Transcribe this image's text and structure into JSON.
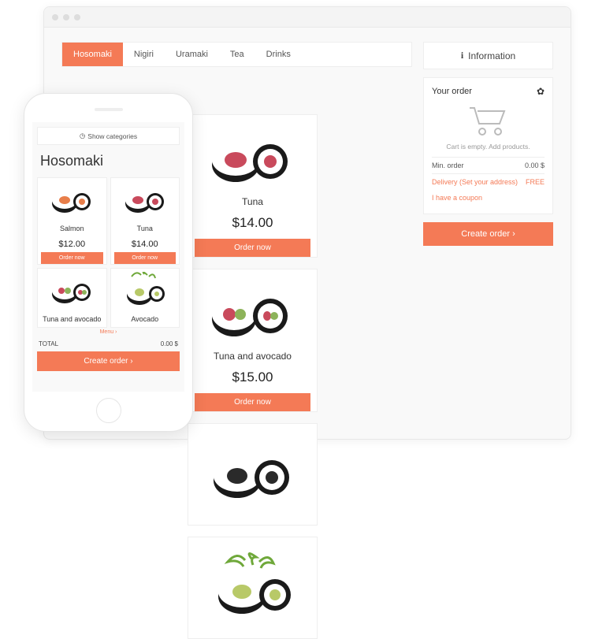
{
  "colors": {
    "accent": "#f47a56"
  },
  "tabs": [
    "Hosomaki",
    "Nigiri",
    "Uramaki",
    "Tea",
    "Drinks"
  ],
  "active_tab": "Hosomaki",
  "products": [
    {
      "name": "Tuna",
      "price": "$14.00",
      "cta": "Order now"
    },
    {
      "name": "Tuna and avocado",
      "price": "$15.00",
      "cta": "Order now"
    }
  ],
  "sidebar": {
    "info_label": "Information",
    "order_title": "Your order",
    "empty_text": "Cart is empty. Add products.",
    "min_order_label": "Min. order",
    "min_order_value": "0.00 $",
    "delivery_label": "Delivery (Set your address)",
    "delivery_value": "FREE",
    "coupon_label": "I have a coupon",
    "create_label": "Create order"
  },
  "mobile": {
    "show_categories": "Show categories",
    "title": "Hosomaki",
    "items": [
      {
        "name": "Salmon",
        "price": "$12.00",
        "cta": "Order now"
      },
      {
        "name": "Tuna",
        "price": "$14.00",
        "cta": "Order now"
      },
      {
        "name": "Tuna and avocado"
      },
      {
        "name": "Avocado"
      }
    ],
    "menu_link": "Menu ›",
    "total_label": "TOTAL",
    "total_value": "0.00 $",
    "create_label": "Create order"
  }
}
